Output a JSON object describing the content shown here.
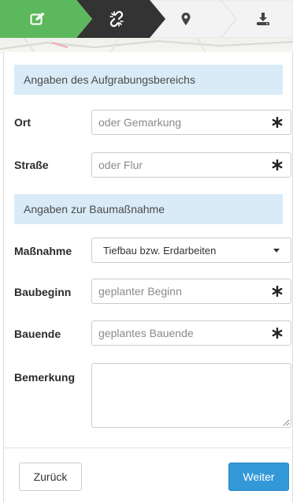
{
  "steps": {
    "items": [
      {
        "icon": "edit-icon",
        "state": "active"
      },
      {
        "icon": "unlink-icon",
        "state": "current"
      },
      {
        "icon": "map-marker-icon",
        "state": "inactive"
      },
      {
        "icon": "download-icon",
        "state": "inactive"
      }
    ],
    "colors": {
      "active": "#5cb85c",
      "current": "#333333",
      "inactive": "#f3f3f3"
    }
  },
  "section_area": {
    "title": "Angaben des Aufgrabungsbereichs"
  },
  "fields_area": [
    {
      "label": "Ort",
      "placeholder": "oder Gemarkung"
    },
    {
      "label": "Straße",
      "placeholder": "oder Flur"
    }
  ],
  "section_measure": {
    "title": "Angaben zur Baumaßnahme"
  },
  "measure": {
    "label": "Maßnahme",
    "selected": "Tiefbau bzw. Erdarbeiten"
  },
  "fields_measure": [
    {
      "label": "Baubeginn",
      "placeholder": "geplanter Beginn"
    },
    {
      "label": "Bauende",
      "placeholder": "geplantes Bauende"
    }
  ],
  "remark": {
    "label": "Bemerkung",
    "value": ""
  },
  "buttons": {
    "back": "Zurück",
    "next": "Weiter"
  },
  "colors": {
    "accent": "#3398d8",
    "section_bg": "#d9ebf7"
  }
}
